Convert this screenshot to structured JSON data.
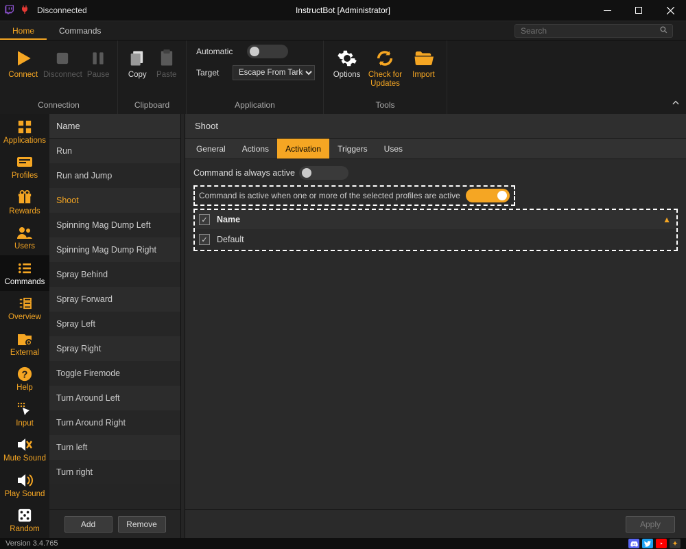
{
  "titlebar": {
    "status": "Disconnected",
    "title": "InstructBot [Administrator]"
  },
  "tabs": {
    "home": "Home",
    "commands": "Commands"
  },
  "search": {
    "placeholder": "Search"
  },
  "ribbon": {
    "connection": {
      "label": "Connection",
      "connect": "Connect",
      "disconnect": "Disconnect",
      "pause": "Pause"
    },
    "clipboard": {
      "label": "Clipboard",
      "copy": "Copy",
      "paste": "Paste"
    },
    "application": {
      "label": "Application",
      "automatic": "Automatic",
      "target": "Target",
      "target_value": "Escape From Tarkov"
    },
    "tools": {
      "label": "Tools",
      "options": "Options",
      "updates": "Check for Updates",
      "import": "Import"
    }
  },
  "sidebar": {
    "items": [
      {
        "label": "Applications"
      },
      {
        "label": "Profiles"
      },
      {
        "label": "Rewards"
      },
      {
        "label": "Users"
      },
      {
        "label": "Commands"
      },
      {
        "label": "Overview"
      },
      {
        "label": "External"
      },
      {
        "label": "Help"
      },
      {
        "label": "Input"
      },
      {
        "label": "Mute Sound"
      },
      {
        "label": "Play Sound"
      },
      {
        "label": "Random"
      }
    ]
  },
  "list": {
    "header": "Name",
    "add": "Add",
    "remove": "Remove",
    "items": [
      "Run",
      "Run and Jump",
      "Shoot",
      "Spinning Mag Dump Left",
      "Spinning Mag Dump Right",
      "Spray Behind",
      "Spray Forward",
      "Spray Left",
      "Spray Right",
      "Toggle Firemode",
      "Turn Around Left",
      "Turn Around Right",
      "Turn left",
      "Turn right"
    ],
    "selected": "Shoot"
  },
  "detail": {
    "title": "Shoot",
    "tabs": {
      "general": "General",
      "actions": "Actions",
      "activation": "Activation",
      "triggers": "Triggers",
      "uses": "Uses"
    },
    "always_active": "Command is always active",
    "profile_active": "Command is active when one or more of the selected profiles are active",
    "profiles_header": "Name",
    "profiles": [
      {
        "name": "Default",
        "checked": true
      }
    ],
    "apply": "Apply"
  },
  "status": {
    "version": "Version 3.4.765"
  }
}
